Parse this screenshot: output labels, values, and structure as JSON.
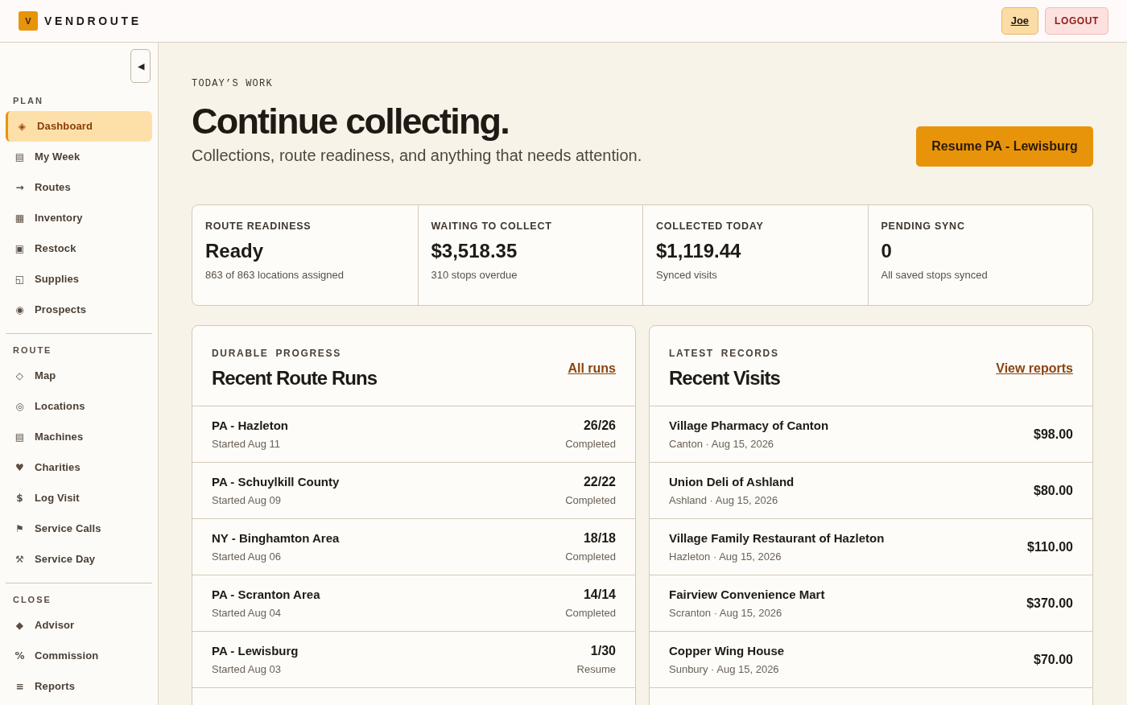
{
  "header": {
    "logo_letter": "V",
    "brand": "VENDROUTE",
    "user_button": "Joe",
    "logout_button": "LOGOUT"
  },
  "sidebar": {
    "collapse_button": "◀",
    "sections": [
      {
        "title": "PLAN",
        "items": [
          {
            "icon": "◈",
            "label": "Dashboard",
            "selected": true
          },
          {
            "icon": "▤",
            "label": "My Week",
            "selected": false
          },
          {
            "icon": "→",
            "label": "Routes",
            "selected": false
          },
          {
            "icon": "▦",
            "label": "Inventory",
            "selected": false
          },
          {
            "icon": "▣",
            "label": "Restock",
            "selected": false
          },
          {
            "icon": "◱",
            "label": "Supplies",
            "selected": false
          },
          {
            "icon": "◉",
            "label": "Prospects",
            "selected": false
          }
        ]
      },
      {
        "title": "ROUTE",
        "items": [
          {
            "icon": "◇",
            "label": "Map",
            "selected": false
          },
          {
            "icon": "◎",
            "label": "Locations",
            "selected": false
          },
          {
            "icon": "▤",
            "label": "Machines",
            "selected": false
          },
          {
            "icon": "♥",
            "label": "Charities",
            "selected": false
          },
          {
            "icon": "$",
            "label": "Log Visit",
            "selected": false
          },
          {
            "icon": "⚑",
            "label": "Service Calls",
            "selected": false
          },
          {
            "icon": "⚒",
            "label": "Service Day",
            "selected": false
          }
        ]
      },
      {
        "title": "CLOSE",
        "items": [
          {
            "icon": "◆",
            "label": "Advisor",
            "selected": false
          },
          {
            "icon": "%",
            "label": "Commission",
            "selected": false
          },
          {
            "icon": "≡",
            "label": "Reports",
            "selected": false
          }
        ]
      }
    ]
  },
  "page": {
    "eyebrow": "TODAY’S WORK",
    "title": "Continue collecting.",
    "subtitle": "Collections, route readiness, and anything that needs attention.",
    "primary_button": "Resume PA - Lewisburg"
  },
  "stats": [
    {
      "label": "ROUTE READINESS",
      "value": "Ready",
      "note": "863 of 863 locations assigned"
    },
    {
      "label": "WAITING TO COLLECT",
      "value": "$3,518.35",
      "note": "310 stops overdue"
    },
    {
      "label": "COLLECTED TODAY",
      "value": "$1,119.44",
      "note": "Synced visits"
    },
    {
      "label": "PENDING SYNC",
      "value": "0",
      "note": "All saved stops synced"
    }
  ],
  "route_runs": {
    "eyebrow": "DURABLE PROGRESS",
    "title": "Recent Route Runs",
    "link": "All runs",
    "rows": [
      {
        "name": "PA - Hazleton",
        "started": "Started Aug 11",
        "count": "26/26",
        "status": "Completed"
      },
      {
        "name": "PA - Schuylkill County",
        "started": "Started Aug 09",
        "count": "22/22",
        "status": "Completed"
      },
      {
        "name": "NY - Binghamton Area",
        "started": "Started Aug 06",
        "count": "18/18",
        "status": "Completed"
      },
      {
        "name": "PA - Scranton Area",
        "started": "Started Aug 04",
        "count": "14/14",
        "status": "Completed"
      },
      {
        "name": "PA - Lewisburg",
        "started": "Started Aug 03",
        "count": "1/30",
        "status": "Resume"
      }
    ]
  },
  "recent_visits": {
    "eyebrow": "LATEST RECORDS",
    "title": "Recent Visits",
    "link": "View reports",
    "rows": [
      {
        "name": "Village Pharmacy of Canton",
        "detail": "Canton · Aug 15, 2026",
        "amount": "$98.00"
      },
      {
        "name": "Union Deli of Ashland",
        "detail": "Ashland · Aug 15, 2026",
        "amount": "$80.00"
      },
      {
        "name": "Village Family Restaurant of Hazleton",
        "detail": "Hazleton · Aug 15, 2026",
        "amount": "$110.00"
      },
      {
        "name": "Fairview Convenience Mart",
        "detail": "Scranton · Aug 15, 2026",
        "amount": "$370.00"
      },
      {
        "name": "Copper Wing House",
        "detail": "Sunbury · Aug 15, 2026",
        "amount": "$70.00"
      }
    ]
  }
}
